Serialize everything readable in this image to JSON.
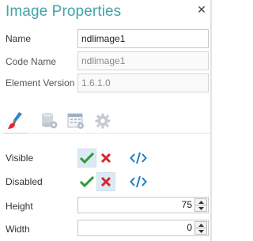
{
  "header": {
    "title": "Image Properties"
  },
  "fields": {
    "name": {
      "label": "Name",
      "value": "ndlimage1"
    },
    "code_name": {
      "label": "Code Name",
      "value": "ndlimage1"
    },
    "element_version": {
      "label": "Element Version",
      "value": "1.6.1.0"
    }
  },
  "tabs": [
    {
      "icon": "brush-icon",
      "active": true
    },
    {
      "icon": "database-gear-icon",
      "active": false
    },
    {
      "icon": "calendar-grid-icon",
      "active": false
    },
    {
      "icon": "gear-icon",
      "active": false
    }
  ],
  "booleans": {
    "visible": {
      "label": "Visible",
      "selected": "true"
    },
    "disabled": {
      "label": "Disabled",
      "selected": "false"
    }
  },
  "numbers": {
    "height": {
      "label": "Height",
      "value": "75"
    },
    "width": {
      "label": "Width",
      "value": "0"
    }
  },
  "colors": {
    "accent": "#41a3a9",
    "check": "#2f9a3a",
    "cross": "#d9232d",
    "code": "#1a7fc4",
    "selected": "#dbeaf5"
  }
}
